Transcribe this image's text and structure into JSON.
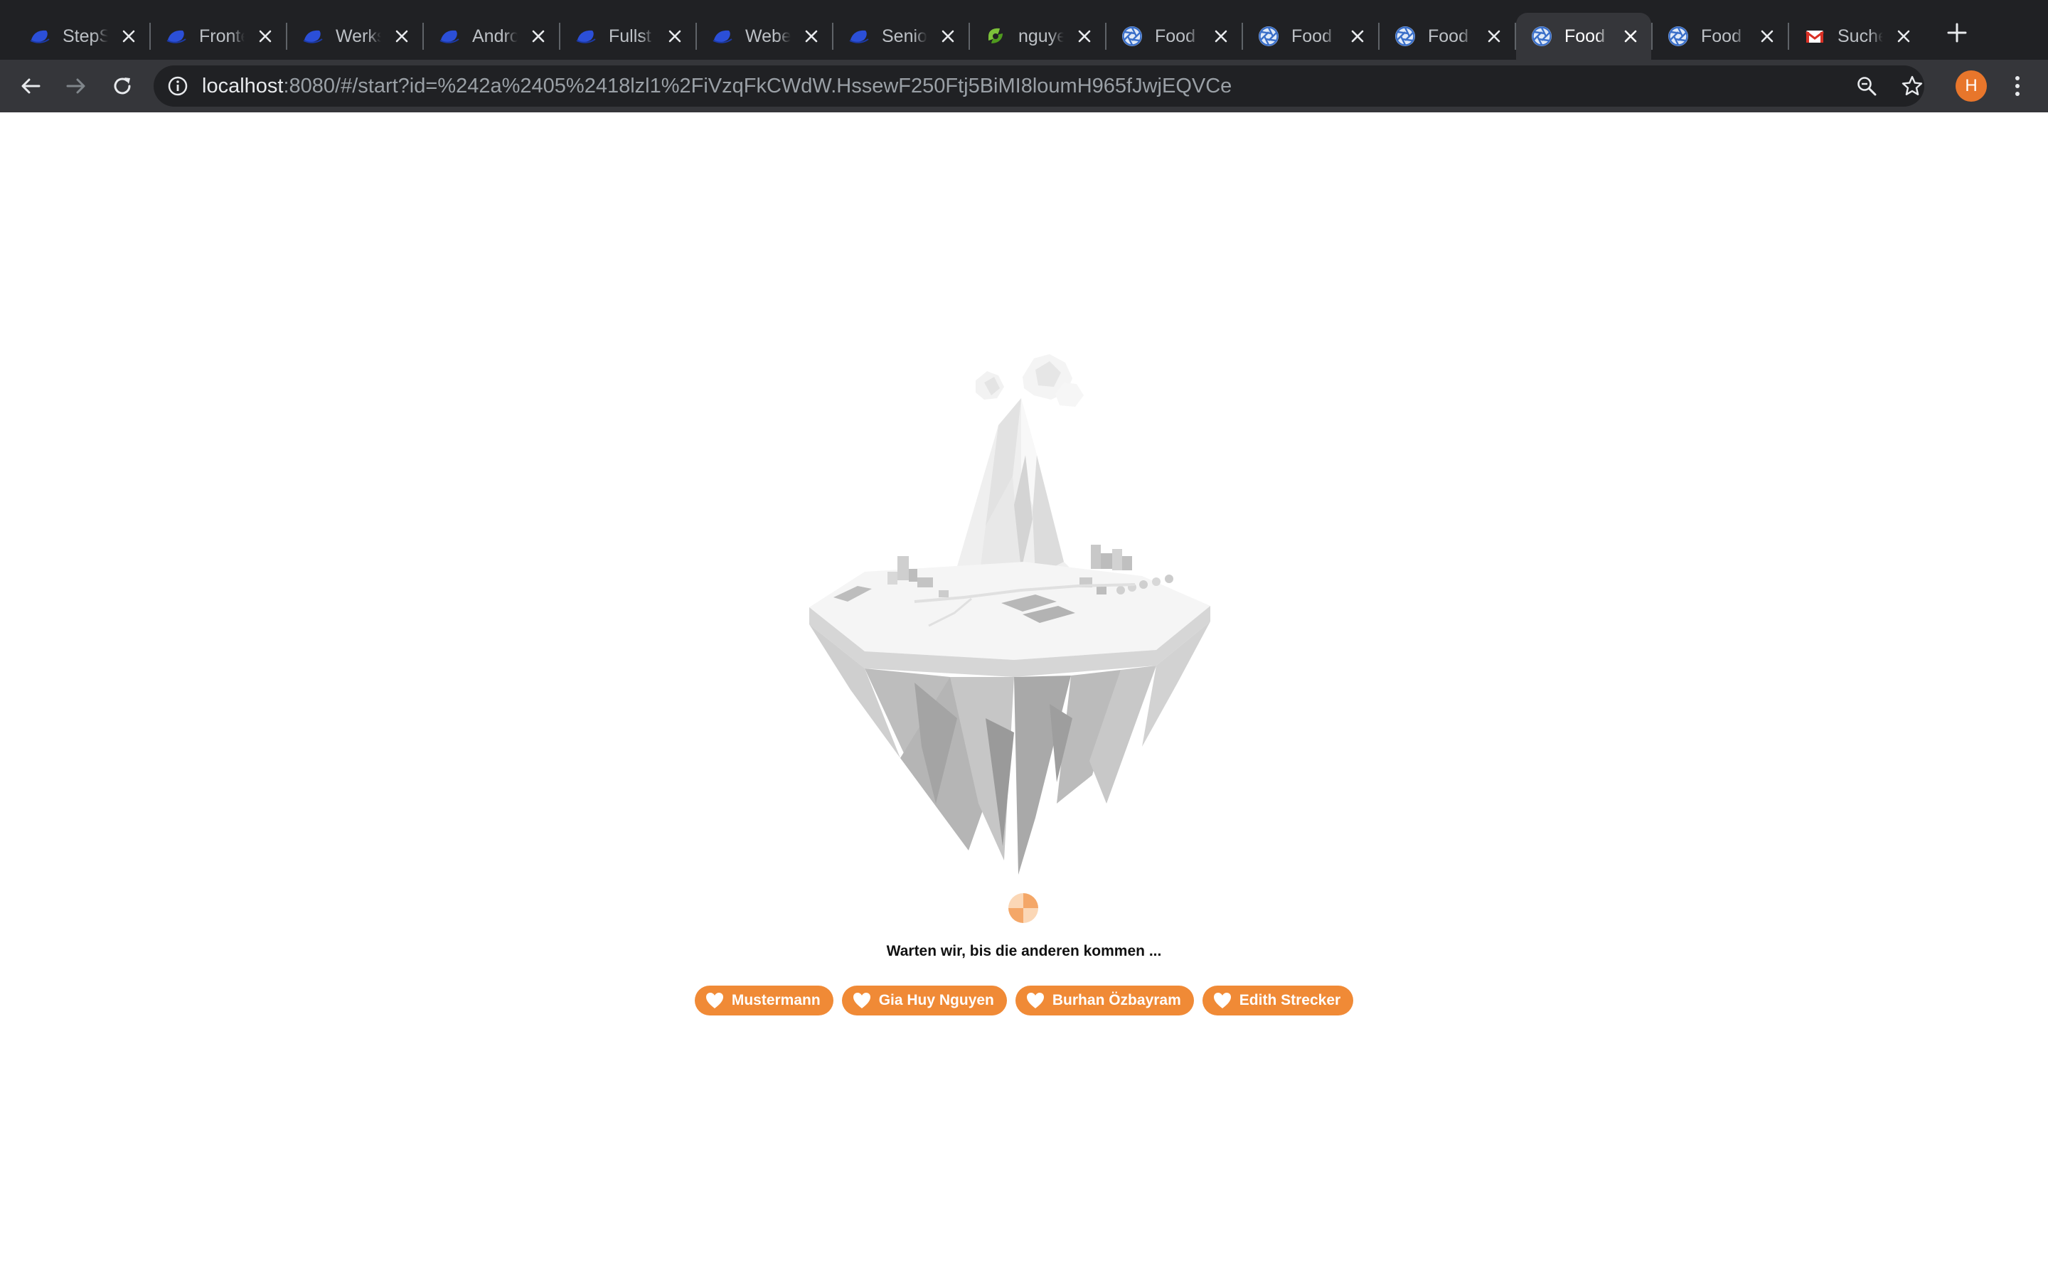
{
  "browser": {
    "tabs": [
      {
        "title": "StepS",
        "favicon": "hat-icon",
        "active": false
      },
      {
        "title": "Fronte",
        "favicon": "hat-icon",
        "active": false
      },
      {
        "title": "Werks",
        "favicon": "hat-icon",
        "active": false
      },
      {
        "title": "Andro",
        "favicon": "hat-icon",
        "active": false
      },
      {
        "title": "Fullst",
        "favicon": "hat-icon",
        "active": false
      },
      {
        "title": "Webe",
        "favicon": "hat-icon",
        "active": false
      },
      {
        "title": "Senio",
        "favicon": "hat-icon",
        "active": false
      },
      {
        "title": "nguye",
        "favicon": "leaf-icon",
        "active": false
      },
      {
        "title": "Food",
        "favicon": "aperture-icon",
        "active": false
      },
      {
        "title": "Food",
        "favicon": "aperture-icon",
        "active": false
      },
      {
        "title": "Food",
        "favicon": "aperture-icon",
        "active": false
      },
      {
        "title": "Food",
        "favicon": "aperture-icon",
        "active": true
      },
      {
        "title": "Food",
        "favicon": "aperture-icon",
        "active": false
      },
      {
        "title": "Suche",
        "favicon": "gmail-icon",
        "active": false
      }
    ],
    "url": {
      "host": "localhost",
      "rest": ":8080/#/start?id=%242a%2405%2418lzl1%2FiVzqFkCWdW.HssewF250Ftj5BiMI8loumH965fJwjEQVCe"
    },
    "profile_initial": "H",
    "colors": {
      "tabstrip": "#202124",
      "toolbar": "#35363a",
      "avatar": "#e8762b"
    }
  },
  "page": {
    "waiting_text": "Warten wir, bis die anderen kommen ...",
    "players": [
      "Mustermann",
      "Gia Huy Nguyen",
      "Burhan Özbayram",
      "Edith Strecker"
    ],
    "colors": {
      "accent": "#f08a36",
      "text": "#111111"
    }
  }
}
